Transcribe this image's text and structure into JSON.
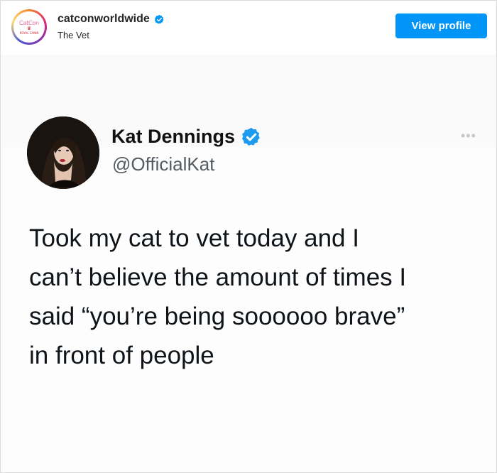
{
  "header": {
    "username": "catconworldwide",
    "subtitle": "The Vet",
    "view_profile_label": "View profile",
    "logo": {
      "top": "CatCon",
      "mid": "♛",
      "bottom": "ROYAL CANIN"
    }
  },
  "tweet": {
    "name": "Kat Dennings",
    "handle": "@OfficialKat",
    "lines": [
      "Took my cat to vet today and I",
      "can’t believe the amount of times I",
      "said “you’re being soooooo brave”",
      "in front of people"
    ],
    "more": "•••"
  },
  "colors": {
    "accent": "#0095f6",
    "verified": "#1d9bf0",
    "handle": "#555b61"
  },
  "icons": [
    "verified-badge-icon",
    "more-options-icon"
  ]
}
